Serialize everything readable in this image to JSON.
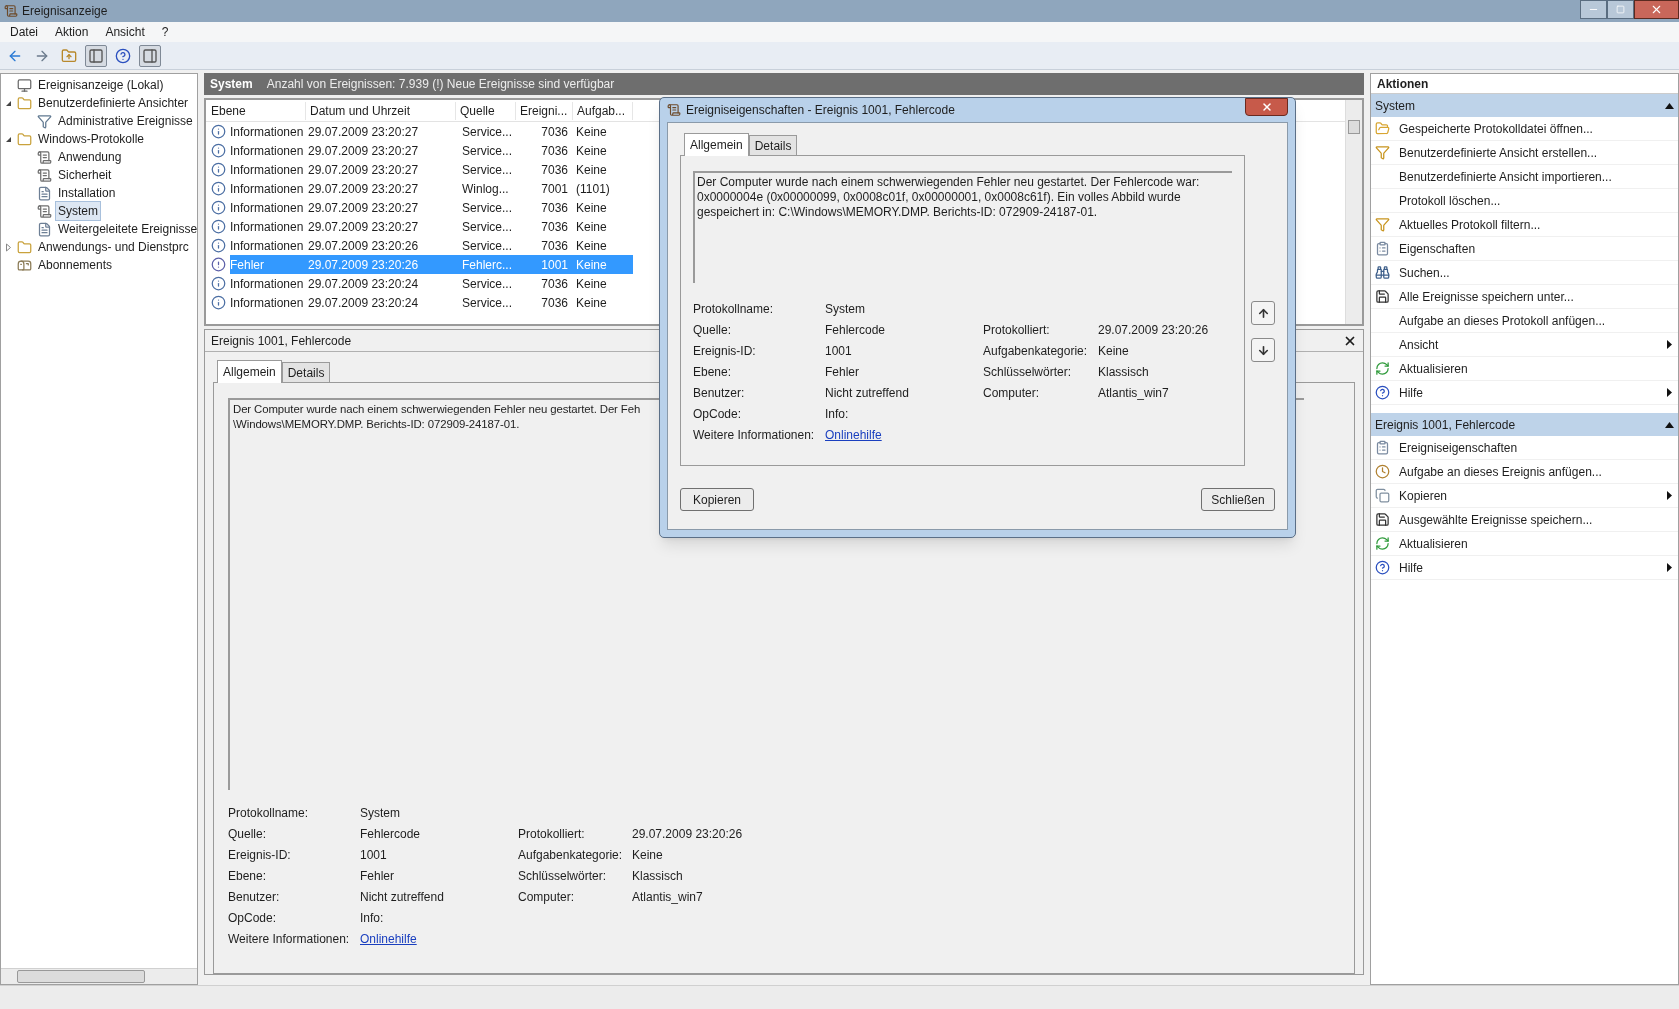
{
  "window": {
    "title": "Ereignisanzeige"
  },
  "menu": [
    "Datei",
    "Aktion",
    "Ansicht",
    "?"
  ],
  "toolbar": [
    {
      "kind": "back",
      "pressed": false
    },
    {
      "kind": "forward",
      "pressed": false
    },
    {
      "kind": "up",
      "pressed": false
    },
    {
      "kind": "tree",
      "pressed": true
    },
    {
      "kind": "help",
      "pressed": false
    },
    {
      "kind": "pane",
      "pressed": true
    }
  ],
  "tree": [
    {
      "label": "Ereignisanzeige (Lokal)",
      "kind": "root",
      "selected": false,
      "children": [
        {
          "label": "Benutzerdefinierte Ansichter",
          "kind": "folder",
          "selected": false,
          "expanded": true,
          "children": [
            {
              "label": "Administrative Ereignisse",
              "kind": "filter",
              "selected": false
            }
          ]
        },
        {
          "label": "Windows-Protokolle",
          "kind": "folder",
          "selected": false,
          "expanded": true,
          "children": [
            {
              "label": "Anwendung",
              "kind": "log",
              "selected": false
            },
            {
              "label": "Sicherheit",
              "kind": "log",
              "selected": false
            },
            {
              "label": "Installation",
              "kind": "plainlog",
              "selected": false
            },
            {
              "label": "System",
              "kind": "log",
              "selected": true
            },
            {
              "label": "Weitergeleitete Ereignisse",
              "kind": "plainlog",
              "selected": false
            }
          ]
        },
        {
          "label": "Anwendungs- und Dienstprc",
          "kind": "folder",
          "selected": false,
          "expanded": false
        },
        {
          "label": "Abonnements",
          "kind": "subscriptions",
          "selected": false
        }
      ]
    }
  ],
  "header": {
    "title": "System",
    "summary": "Anzahl von Ereignissen: 7.939 (!) Neue Ereignisse sind verfügbar"
  },
  "table": {
    "columns": [
      "Ebene",
      "Datum und Uhrzeit",
      "Quelle",
      "Ereigni...",
      "Aufgab..."
    ],
    "rows": [
      {
        "kind": "info",
        "cells": [
          "Informationen",
          "29.07.2009 23:20:27",
          "Service...",
          "7036",
          "Keine"
        ],
        "selected": false
      },
      {
        "kind": "info",
        "cells": [
          "Informationen",
          "29.07.2009 23:20:27",
          "Service...",
          "7036",
          "Keine"
        ],
        "selected": false
      },
      {
        "kind": "info",
        "cells": [
          "Informationen",
          "29.07.2009 23:20:27",
          "Service...",
          "7036",
          "Keine"
        ],
        "selected": false
      },
      {
        "kind": "info",
        "cells": [
          "Informationen",
          "29.07.2009 23:20:27",
          "Winlog...",
          "7001",
          "(1101)"
        ],
        "selected": false
      },
      {
        "kind": "info",
        "cells": [
          "Informationen",
          "29.07.2009 23:20:27",
          "Service...",
          "7036",
          "Keine"
        ],
        "selected": false
      },
      {
        "kind": "info",
        "cells": [
          "Informationen",
          "29.07.2009 23:20:27",
          "Service...",
          "7036",
          "Keine"
        ],
        "selected": false
      },
      {
        "kind": "info",
        "cells": [
          "Informationen",
          "29.07.2009 23:20:26",
          "Service...",
          "7036",
          "Keine"
        ],
        "selected": false
      },
      {
        "kind": "error",
        "cells": [
          "Fehler",
          "29.07.2009 23:20:26",
          "Fehlerc...",
          "1001",
          "Keine"
        ],
        "selected": true
      },
      {
        "kind": "info",
        "cells": [
          "Informationen",
          "29.07.2009 23:20:24",
          "Service...",
          "7036",
          "Keine"
        ],
        "selected": false
      },
      {
        "kind": "info",
        "cells": [
          "Informationen",
          "29.07.2009 23:20:24",
          "Service...",
          "7036",
          "Keine"
        ],
        "selected": false
      }
    ]
  },
  "detail": {
    "title": "Ereignis 1001, Fehlercode",
    "tabs": [
      {
        "label": "Allgemein",
        "selected": true
      },
      {
        "label": "Details",
        "selected": false
      }
    ],
    "message_lines": [
      "Der Computer wurde nach einem schwerwiegenden Fehler neu gestartet. Der Feh",
      "\\Windows\\MEMORY.DMP. Berichts-ID: 072909-24187-01."
    ],
    "rows": [
      {
        "label": "Protokollname:",
        "value": "System"
      },
      {
        "label": "Quelle:",
        "value": "Fehlercode",
        "label2": "Protokolliert:",
        "value2": "29.07.2009 23:20:26"
      },
      {
        "label": "Ereignis-ID:",
        "value": "1001",
        "label2": "Aufgabenkategorie:",
        "value2": "Keine"
      },
      {
        "label": "Ebene:",
        "value": "Fehler",
        "label2": "Schlüsselwörter:",
        "value2": "Klassisch"
      },
      {
        "label": "Benutzer:",
        "value": "Nicht zutreffend",
        "label2": "Computer:",
        "value2": "Atlantis_win7"
      },
      {
        "label": "OpCode:",
        "value": "Info:"
      },
      {
        "label": "Weitere Informationen:",
        "link": "Onlinehilfe"
      }
    ]
  },
  "dialog": {
    "title": "Ereigniseigenschaften - Ereignis 1001, Fehlercode",
    "tabs": [
      {
        "label": "Allgemein",
        "selected": true
      },
      {
        "label": "Details",
        "selected": false
      }
    ],
    "message": "Der Computer wurde nach einem schwerwiegenden Fehler neu gestartet. Der Fehlercode war: 0x0000004e (0x00000099, 0x0008c01f, 0x00000001, 0x0008c61f). Ein volles Abbild wurde gespeichert in: C:\\Windows\\MEMORY.DMP. Berichts-ID: 072909-24187-01.",
    "rows": [
      {
        "label": "Protokollname:",
        "value": "System"
      },
      {
        "label": "Quelle:",
        "value": "Fehlercode",
        "label2": "Protokolliert:",
        "value2": "29.07.2009 23:20:26"
      },
      {
        "label": "Ereignis-ID:",
        "value": "1001",
        "label2": "Aufgabenkategorie:",
        "value2": "Keine"
      },
      {
        "label": "Ebene:",
        "value": "Fehler",
        "label2": "Schlüsselwörter:",
        "value2": "Klassisch"
      },
      {
        "label": "Benutzer:",
        "value": "Nicht zutreffend",
        "label2": "Computer:",
        "value2": "Atlantis_win7"
      },
      {
        "label": "OpCode:",
        "value": "Info:"
      },
      {
        "label": "Weitere Informationen:",
        "link": "Onlinehilfe"
      }
    ],
    "buttons": [
      "Kopieren",
      "Schließen"
    ]
  },
  "actions": {
    "title": "Aktionen",
    "sections": [
      {
        "title": "System",
        "expanded": true,
        "items": [
          {
            "label": "Gespeicherte Protokolldatei öffnen...",
            "kind": "folder",
            "submenu": false
          },
          {
            "label": "Benutzerdefinierte Ansicht erstellen...",
            "kind": "filter",
            "submenu": false
          },
          {
            "label": "Benutzerdefinierte Ansicht importieren...",
            "kind": "plain",
            "submenu": false
          },
          {
            "label": "Protokoll löschen...",
            "kind": "plain",
            "submenu": false
          },
          {
            "label": "Aktuelles Protokoll filtern...",
            "kind": "filter",
            "submenu": false
          },
          {
            "label": "Eigenschaften",
            "kind": "properties",
            "submenu": false
          },
          {
            "label": "Suchen...",
            "kind": "find",
            "submenu": false
          },
          {
            "label": "Alle Ereignisse speichern unter...",
            "kind": "save",
            "submenu": false
          },
          {
            "label": "Aufgabe an dieses Protokoll anfügen...",
            "kind": "plain",
            "submenu": false
          },
          {
            "label": "Ansicht",
            "kind": "plain",
            "submenu": true
          },
          {
            "label": "Aktualisieren",
            "kind": "refresh",
            "submenu": false
          },
          {
            "label": "Hilfe",
            "kind": "help",
            "submenu": true
          }
        ]
      },
      {
        "title": "Ereignis 1001, Fehlercode",
        "expanded": true,
        "items": [
          {
            "label": "Ereigniseigenschaften",
            "kind": "properties",
            "submenu": false
          },
          {
            "label": "Aufgabe an dieses Ereignis anfügen...",
            "kind": "task",
            "submenu": false
          },
          {
            "label": "Kopieren",
            "kind": "copy",
            "submenu": true
          },
          {
            "label": "Ausgewählte Ereignisse speichern...",
            "kind": "save",
            "submenu": false
          },
          {
            "label": "Aktualisieren",
            "kind": "refresh",
            "submenu": false
          },
          {
            "label": "Hilfe",
            "kind": "help",
            "submenu": true
          }
        ]
      }
    ]
  }
}
